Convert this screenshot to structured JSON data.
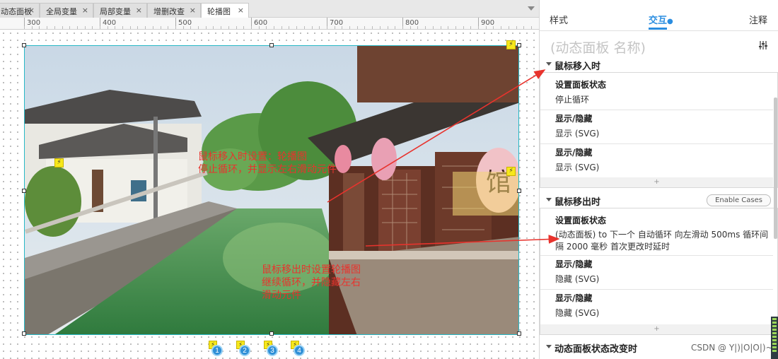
{
  "tabs": [
    {
      "label": "动态面板",
      "active": false
    },
    {
      "label": "全局变量",
      "active": false
    },
    {
      "label": "局部变量",
      "active": false
    },
    {
      "label": "增删改查",
      "active": false
    },
    {
      "label": "轮播图",
      "active": true
    }
  ],
  "tab_close_glyph": "×",
  "ruler": {
    "ticks": [
      "300",
      "400",
      "500",
      "600",
      "700",
      "800",
      "900"
    ]
  },
  "canvas": {
    "annotation_enter": [
      "鼠标移入时设置：轮播图",
      "停止循环，并显示左右滑动元件"
    ],
    "annotation_leave": [
      "鼠标移出时设置轮播图",
      "继续循环，并隐藏左右",
      "滑动元件"
    ],
    "pager_buttons": [
      "1",
      "2",
      "3",
      "4"
    ],
    "shop_sign_char": "馆"
  },
  "panel": {
    "tabs": {
      "style": "样式",
      "interaction": "交互",
      "notes": "注释"
    },
    "panel_name_placeholder": "(动态面板 名称)",
    "events": [
      {
        "name": "鼠标移入时",
        "actions": [
          {
            "title": "设置面板状态",
            "desc": "停止循环"
          },
          {
            "title": "显示/隐藏",
            "desc": "显示 (SVG)"
          },
          {
            "title": "显示/隐藏",
            "desc": "显示 (SVG)"
          }
        ]
      },
      {
        "name": "鼠标移出时",
        "enable_cases": "Enable Cases",
        "actions": [
          {
            "title": "设置面板状态",
            "desc": "(动态面板) to 下一个 自动循环 向左滑动 500ms 循环间隔 2000 毫秒 首次更改时延时"
          },
          {
            "title": "显示/隐藏",
            "desc": "隐藏 (SVG)"
          },
          {
            "title": "显示/隐藏",
            "desc": "隐藏 (SVG)"
          }
        ]
      },
      {
        "name": "动态面板状态改变时"
      }
    ],
    "add_glyph": "+",
    "watermark": "CSDN @ Y|)|O|O|)~"
  },
  "colors": {
    "accent": "#2a8de0",
    "annotation": "#e8332d",
    "selection": "#27b8c6"
  }
}
